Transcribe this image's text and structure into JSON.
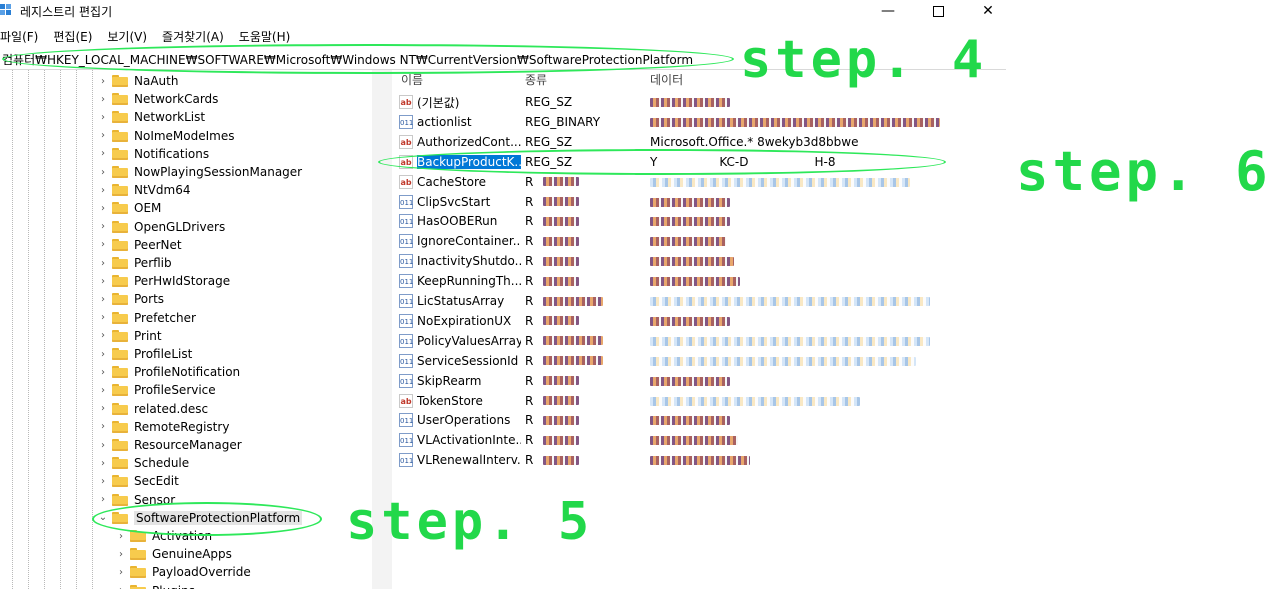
{
  "window": {
    "title": "레지스트리 편집기",
    "minimize_icon": "minimize-icon",
    "maximize_icon": "maximize-icon",
    "close_icon": "close-icon"
  },
  "menu": [
    "파일(F)",
    "편집(E)",
    "보기(V)",
    "즐겨찾기(A)",
    "도움말(H)"
  ],
  "address": "컴퓨터₩HKEY_LOCAL_MACHINE₩SOFTWARE₩Microsoft₩Windows NT₩CurrentVersion₩SoftwareProtectionPlatform",
  "tree": {
    "items": [
      {
        "label": "NaAuth",
        "level": 1
      },
      {
        "label": "NetworkCards",
        "level": 1
      },
      {
        "label": "NetworkList",
        "level": 1
      },
      {
        "label": "NoImeModeImes",
        "level": 1
      },
      {
        "label": "Notifications",
        "level": 1
      },
      {
        "label": "NowPlayingSessionManager",
        "level": 1
      },
      {
        "label": "NtVdm64",
        "level": 1
      },
      {
        "label": "OEM",
        "level": 1
      },
      {
        "label": "OpenGLDrivers",
        "level": 1
      },
      {
        "label": "PeerNet",
        "level": 1
      },
      {
        "label": "Perflib",
        "level": 1
      },
      {
        "label": "PerHwIdStorage",
        "level": 1
      },
      {
        "label": "Ports",
        "level": 1
      },
      {
        "label": "Prefetcher",
        "level": 1
      },
      {
        "label": "Print",
        "level": 1
      },
      {
        "label": "ProfileList",
        "level": 1
      },
      {
        "label": "ProfileNotification",
        "level": 1
      },
      {
        "label": "ProfileService",
        "level": 1
      },
      {
        "label": "related.desc",
        "level": 1
      },
      {
        "label": "RemoteRegistry",
        "level": 1
      },
      {
        "label": "ResourceManager",
        "level": 1
      },
      {
        "label": "Schedule",
        "level": 1
      },
      {
        "label": "SecEdit",
        "level": 1
      },
      {
        "label": "Sensor",
        "level": 1
      },
      {
        "label": "SoftwareProtectionPlatform",
        "level": 1,
        "expanded": true,
        "selected": true
      },
      {
        "label": "Activation",
        "level": 2
      },
      {
        "label": "GenuineApps",
        "level": 2
      },
      {
        "label": "PayloadOverride",
        "level": 2
      },
      {
        "label": "Plugins",
        "level": 2
      }
    ]
  },
  "list": {
    "columns": [
      "이름",
      "종류",
      "데이터"
    ],
    "rows": [
      {
        "name": "(기본값)",
        "type": "REG_SZ",
        "data": "",
        "icon": "string-value-icon"
      },
      {
        "name": "actionlist",
        "type": "REG_BINARY",
        "data": "",
        "icon": "binary-value-icon"
      },
      {
        "name": "AuthorizedCont...",
        "type": "REG_SZ",
        "data": "Microsoft.Office.* 8wekyb3d8bbwe",
        "icon": "string-value-icon"
      },
      {
        "name": "BackupProductK...",
        "type": "REG_SZ",
        "data": "Y",
        "data_mid": "KC-D",
        "data_end": "H-8",
        "icon": "string-value-icon",
        "highlighted": true
      },
      {
        "name": "CacheStore",
        "type": "R",
        "data": "",
        "icon": "string-value-icon"
      },
      {
        "name": "ClipSvcStart",
        "type": "R",
        "data": "",
        "icon": "binary-value-icon"
      },
      {
        "name": "HasOOBERun",
        "type": "R",
        "data": "",
        "icon": "binary-value-icon"
      },
      {
        "name": "IgnoreContainer...",
        "type": "R",
        "data": "",
        "icon": "binary-value-icon"
      },
      {
        "name": "InactivityShutdo...",
        "type": "R",
        "data": "",
        "icon": "binary-value-icon"
      },
      {
        "name": "KeepRunningTh...",
        "type": "R",
        "data": "",
        "icon": "binary-value-icon"
      },
      {
        "name": "LicStatusArray",
        "type": "R",
        "data": "",
        "icon": "binary-value-icon"
      },
      {
        "name": "NoExpirationUX",
        "type": "R",
        "data": "",
        "icon": "binary-value-icon"
      },
      {
        "name": "PolicyValuesArray",
        "type": "R",
        "data": "",
        "icon": "binary-value-icon"
      },
      {
        "name": "ServiceSessionId",
        "type": "R",
        "data": "",
        "icon": "binary-value-icon"
      },
      {
        "name": "SkipRearm",
        "type": "R",
        "data": "",
        "icon": "binary-value-icon"
      },
      {
        "name": "TokenStore",
        "type": "R",
        "data": "",
        "icon": "string-value-icon"
      },
      {
        "name": "UserOperations",
        "type": "R",
        "data": "",
        "icon": "binary-value-icon"
      },
      {
        "name": "VLActivationInte...",
        "type": "R",
        "data": "",
        "icon": "binary-value-icon"
      },
      {
        "name": "VLRenewalInterv...",
        "type": "R",
        "data": "",
        "icon": "binary-value-icon"
      }
    ]
  },
  "annotations": {
    "step4": "step. 4",
    "step5": "step. 5",
    "step6": "step. 6",
    "color": "#2ee85a"
  }
}
